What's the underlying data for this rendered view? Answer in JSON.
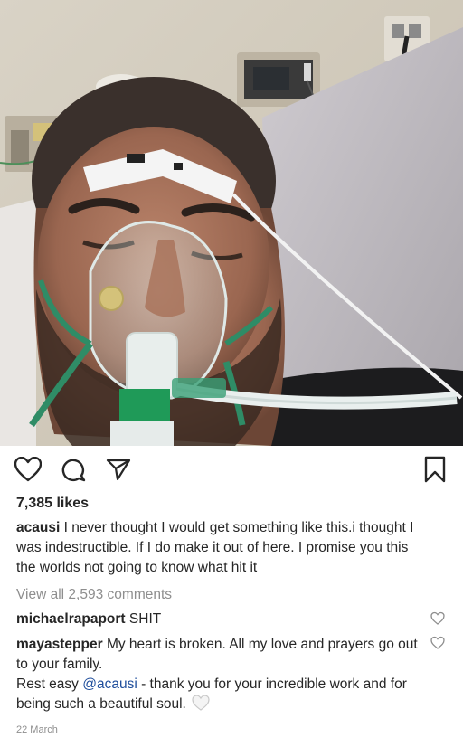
{
  "post": {
    "likes": "7,385 likes",
    "caption": {
      "username": "acausi",
      "text": "I never thought I would get something like this.i thought  I was indestructible. If I do make it out of here. I promise you this the worlds not going to know what hit it"
    },
    "view_all_comments": "View all 2,593 comments",
    "comments": [
      {
        "username": "michaelrapaport",
        "text": "SHIT"
      },
      {
        "username": "mayastepper",
        "text_part1": "My heart is broken. All my love and prayers go out to your family.",
        "text_part2": "Rest easy ",
        "mention": "@acausi",
        "text_part3": " - thank you for your incredible work and for being such a beautiful soul.",
        "emoji": "white-heart"
      }
    ],
    "date": "22 March"
  },
  "icons": {
    "like": "heart-outline-icon",
    "comment": "comment-bubble-icon",
    "share": "paper-plane-icon",
    "save": "bookmark-icon",
    "comment_like": "small-heart-icon"
  },
  "colors": {
    "text": "#262626",
    "muted": "#8e8e8e",
    "mention": "#1f4e9c",
    "background": "#ffffff"
  }
}
